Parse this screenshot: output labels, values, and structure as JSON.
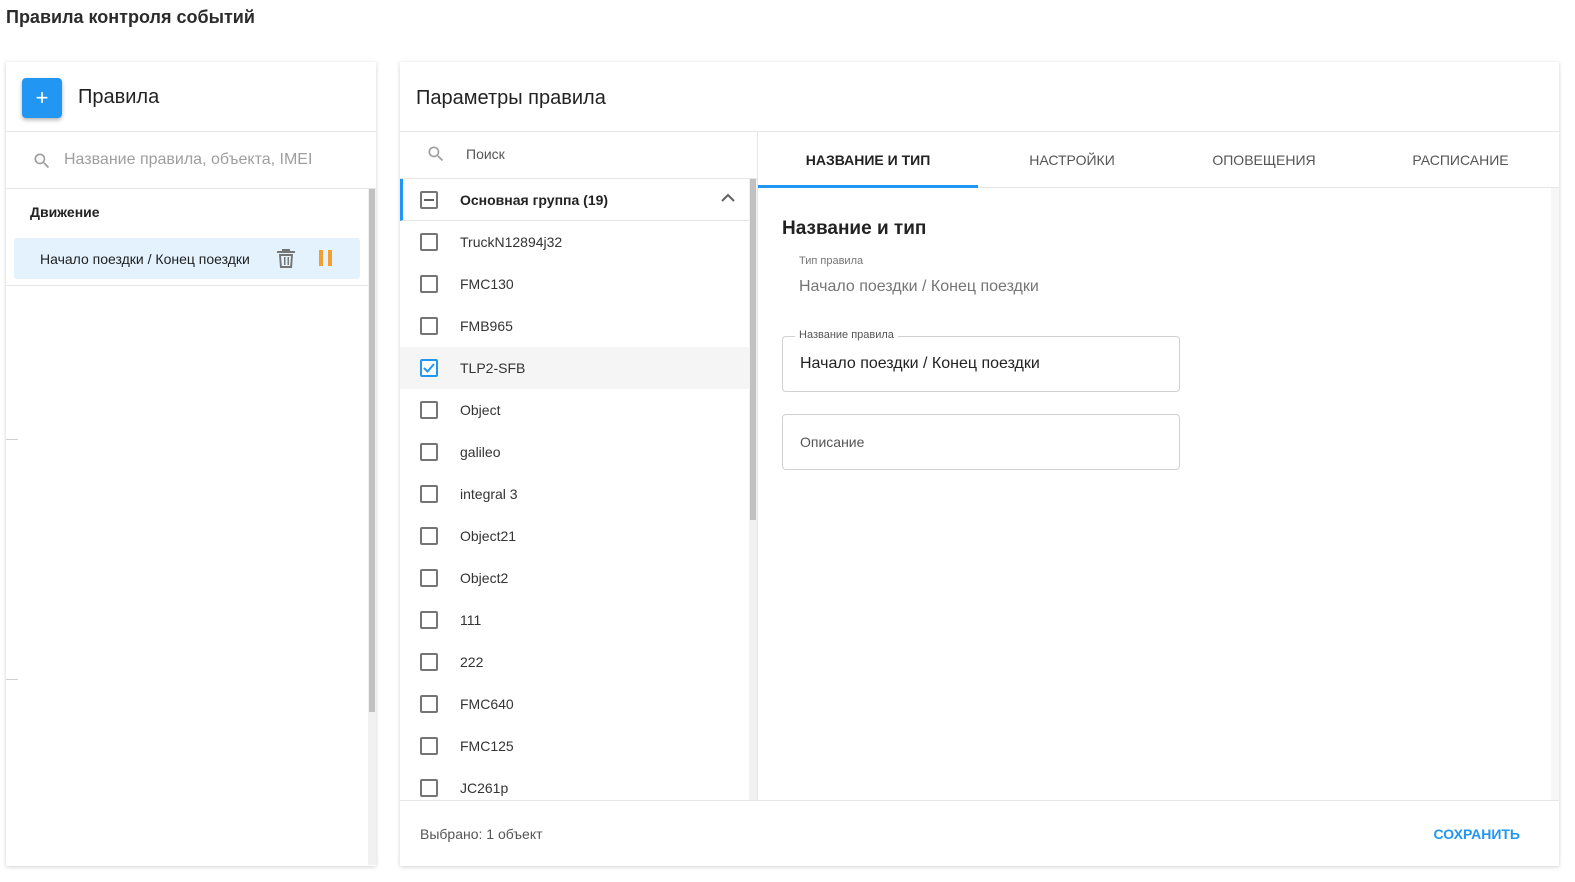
{
  "page": {
    "title": "Правила контроля событий"
  },
  "rules_panel": {
    "add_label": "+",
    "title": "Правила",
    "search_placeholder": "Название правила, объекта, IMEI",
    "group_label": "Движение",
    "rules": [
      {
        "label": "Начало поездки / Конец поездки"
      }
    ]
  },
  "params_panel": {
    "title": "Параметры правила",
    "objects": {
      "search_placeholder": "Поиск",
      "group": {
        "label": "Основная группа (19)"
      },
      "items": [
        {
          "name": "TruckN12894j32",
          "checked": false
        },
        {
          "name": "FMC130",
          "checked": false
        },
        {
          "name": "FMB965",
          "checked": false
        },
        {
          "name": "TLP2-SFB",
          "checked": true
        },
        {
          "name": "Object",
          "checked": false
        },
        {
          "name": "galileo",
          "checked": false
        },
        {
          "name": "integral 3",
          "checked": false
        },
        {
          "name": "Object21",
          "checked": false
        },
        {
          "name": "Object2",
          "checked": false
        },
        {
          "name": "111",
          "checked": false
        },
        {
          "name": "222",
          "checked": false
        },
        {
          "name": "FMC640",
          "checked": false
        },
        {
          "name": "FMC125",
          "checked": false
        },
        {
          "name": "JC261p",
          "checked": false
        }
      ]
    },
    "tabs": [
      {
        "label": "НАЗВАНИЕ И ТИП"
      },
      {
        "label": "НАСТРОЙКИ"
      },
      {
        "label": "ОПОВЕЩЕНИЯ"
      },
      {
        "label": "РАСПИСАНИЕ"
      }
    ],
    "active_tab": "НАЗВАНИЕ И ТИП",
    "form": {
      "section_title": "Название и тип",
      "rule_type_label": "Тип правила",
      "rule_type_value": "Начало поездки / Конец поездки",
      "rule_name_label": "Название правила",
      "rule_name_value": "Начало поездки / Конец поездки",
      "description_placeholder": "Описание"
    },
    "footer": {
      "selected_text": "Выбрано: 1 объект",
      "save_label": "СОХРАНИТЬ"
    }
  },
  "colors": {
    "accent": "#2196f3",
    "pause": "#f0a030",
    "selected_rule_bg": "#e3f2fd"
  },
  "icons": [
    "search-icon",
    "trash-icon",
    "pause-icon",
    "chevron-up-icon",
    "checkbox-icon"
  ]
}
